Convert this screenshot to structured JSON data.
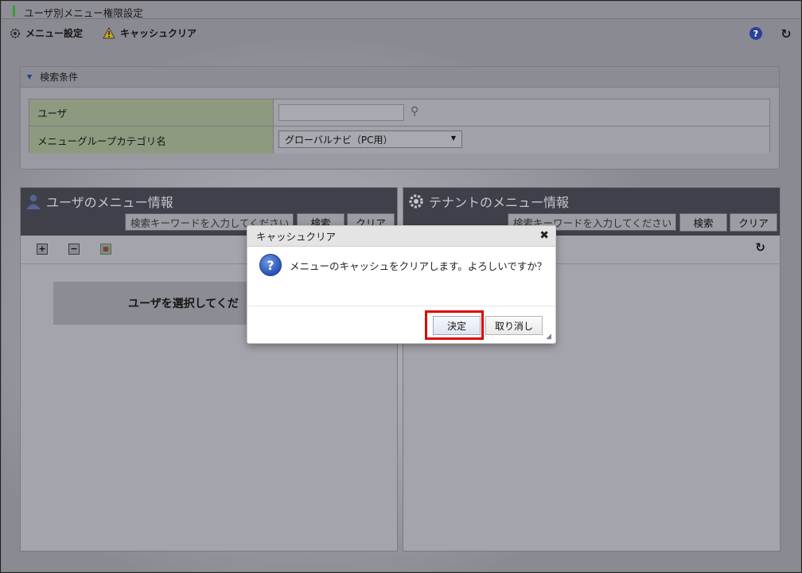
{
  "window": {
    "title": "ユーザ別メニュー権限設定"
  },
  "toolbar": {
    "menu_settings": "メニュー設定",
    "cache_clear": "キャッシュクリア",
    "help_icon": "help-icon",
    "reload_icon": "reload-icon"
  },
  "search": {
    "header": "検索条件",
    "user_label": "ユーザ",
    "user_value": "",
    "category_label": "メニューグループカテゴリ名",
    "category_value": "グローバルナビ（PC用）"
  },
  "left_pane": {
    "title": "ユーザのメニュー情報",
    "keyword_placeholder": "検索キーワードを入力してください",
    "search_button": "検索",
    "clear_button": "クリア",
    "select_message": "ユーザを選択してくだ"
  },
  "right_pane": {
    "title": "テナントのメニュー情報",
    "keyword_placeholder": "検索キーワードを入力してください",
    "search_button": "検索",
    "clear_button": "クリア"
  },
  "dialog": {
    "title": "キャッシュクリア",
    "message": "メニューのキャッシュをクリアします。よろしいですか？",
    "ok_button": "決定",
    "cancel_button": "取り消し"
  },
  "colors": {
    "highlight": "#e00000",
    "title_mark": "#3a9a3a"
  }
}
